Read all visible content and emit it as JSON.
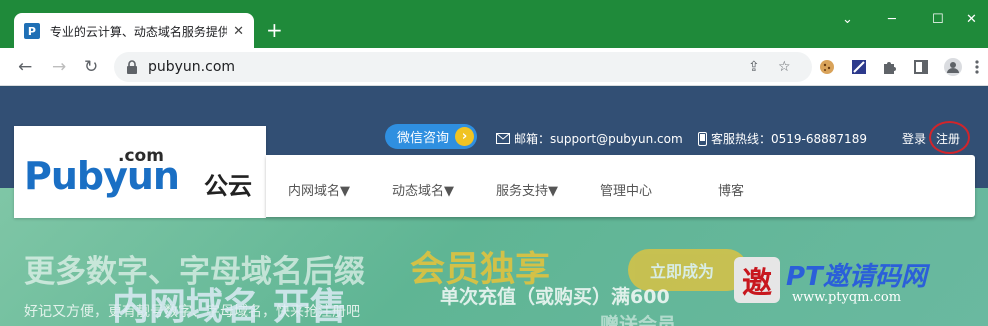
{
  "browser": {
    "tab_title": "专业的云计算、动态域名服务提供商",
    "tab_favicon": "P",
    "new_tab": "+",
    "url": "pubyun.com",
    "window_controls": {
      "minimize": "─",
      "maximize": "☐",
      "close": "✕",
      "tab_list": "⌄"
    },
    "nav": {
      "back": "←",
      "forward": "→",
      "reload": "↻"
    },
    "omnibox_icons": {
      "share": "⇪",
      "bookmark": "☆"
    },
    "extensions": [
      "cookie-icon",
      "extension-icon",
      "puzzle-icon",
      "sidebar-icon",
      "profile-icon",
      "menu-icon"
    ]
  },
  "site": {
    "logo": {
      "com": ".com",
      "main": "Pubyun",
      "cn": "公云"
    },
    "wechat_button": "微信咨询",
    "email_label": "邮箱：",
    "email": "support@pubyun.com",
    "hotline_label": "客服热线：",
    "hotline": "0519-68887189",
    "login": "登录",
    "register": "注册",
    "nav": [
      "内网域名▼",
      "动态域名▼",
      "服务支持▼",
      "管理中心",
      "博客"
    ]
  },
  "hero": {
    "headline": "更多数字、字母域名后缀",
    "highlight": "会员独享",
    "button": "立即成为",
    "sub1": "好记又方便，更有靓号数字、字母域名，快来抢注册吧",
    "big": "内网域名 开售",
    "sub2": "单次充值（或购买）满600",
    "sub3": "赠送会员"
  },
  "watermark": {
    "glyph": "邀",
    "text": "PT邀请码网",
    "url": "www.ptyqm.com"
  },
  "colors": {
    "chrome": "#1f8a3a",
    "page_header": "#324f74",
    "brand_blue": "#1a6fc4",
    "accent_yellow": "#e8c43a",
    "annotation_red": "#d0252b"
  }
}
